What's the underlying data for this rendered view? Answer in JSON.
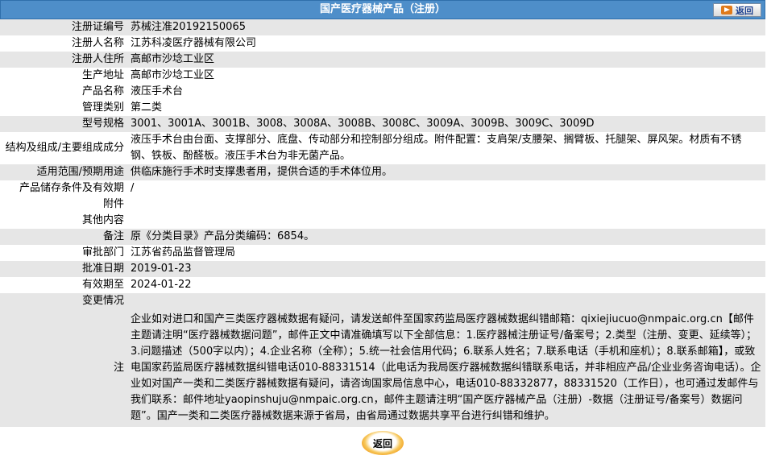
{
  "header": {
    "title": "国产医疗器械产品（注册）",
    "back_label": "返回"
  },
  "rows": [
    {
      "label": "注册证编号",
      "value": "苏械注准20192150065"
    },
    {
      "label": "注册人名称",
      "value": "江苏科凌医疗器械有限公司"
    },
    {
      "label": "注册人住所",
      "value": "高邮市沙埝工业区"
    },
    {
      "label": "生产地址",
      "value": "高邮市沙埝工业区"
    },
    {
      "label": "产品名称",
      "value": "液压手术台"
    },
    {
      "label": "管理类别",
      "value": "第二类"
    },
    {
      "label": "型号规格",
      "value": "3001、3001A、3001B、3008、3008A、3008B、3008C、3009A、3009B、3009C、3009D"
    },
    {
      "label": "结构及组成/主要组成成分",
      "value": "液压手术台由台面、支撑部分、底盘、传动部分和控制部分组成。附件配置：支肩架/支腰架、搁臂板、托腿架、屏风架。材质有不锈钢、铁板、酚醛板。液压手术台为非无菌产品。"
    },
    {
      "label": "适用范围/预期用途",
      "value": "供临床施行手术时支撑患者用，提供合适的手术体位用。"
    },
    {
      "label": "产品储存条件及有效期",
      "value": "/"
    },
    {
      "label": "附件",
      "value": ""
    },
    {
      "label": "其他内容",
      "value": ""
    },
    {
      "label": "备注",
      "value": "原《分类目录》产品分类编码：6854。"
    },
    {
      "label": "审批部门",
      "value": "江苏省药品监督管理局"
    },
    {
      "label": "批准日期",
      "value": "2019-01-23"
    },
    {
      "label": "有效期至",
      "value": "2024-01-22"
    },
    {
      "label": "变更情况",
      "value": ""
    }
  ],
  "note": {
    "label": "注",
    "text": "企业如对进口和国产三类医疗器械数据有疑问，请发送邮件至国家药监局医疗器械数据纠错邮箱：qixiejiucuo@nmpaic.org.cn【邮件主题请注明“医疗器械数据问题”，邮件正文中请准确填写以下全部信息：1.医疗器械注册证号/备案号；2.类型（注册、变更、延续等）；3.问题描述（500字以内）；4.企业名称（全称）；5.统一社会信用代码；6.联系人姓名；7.联系电话（手机和座机）；8.联系邮箱】，或致电国家药监局医疗器械数据纠错电话010-88331514（此电话为我局医疗器械数据纠错联系电话，并非相应产品/企业业务咨询电话）。企业如对国产一类和二类医疗器械数据有疑问，请咨询国家局信息中心，电话010-88332877，88331520（工作日），也可通过发邮件与我们联系：邮件地址yaopinshuju@nmpaic.org.cn，邮件主题请注明“国产医疗器械产品（注册）-数据（注册证号/备案号）数据问题”。国产一类和二类医疗器械数据来源于省局，由省局通过数据共享平台进行纠错和维护。"
  },
  "footer": {
    "back_label": "返回"
  },
  "colors": {
    "header_bg": "#4e8ec9",
    "row_alt_bg": "#e6e6e6",
    "button_accent": "#f09a1a"
  }
}
